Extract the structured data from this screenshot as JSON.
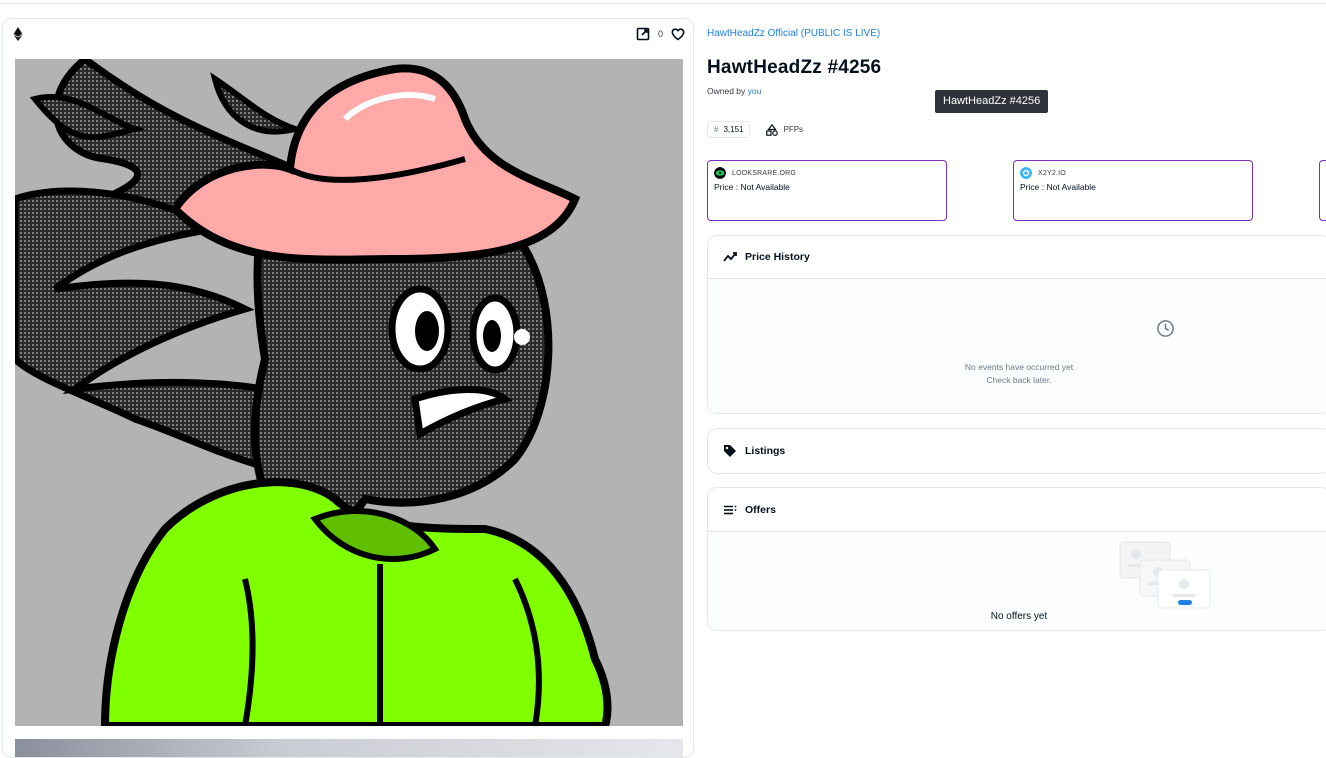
{
  "media": {
    "chain_icon": "ethereum-icon",
    "external_icon": "external-link-icon",
    "favorite_icon": "heart-icon",
    "favorite_count": "0",
    "art_icon": "nft-artwork-image"
  },
  "item": {
    "collection": "HawtHeadZz Official (PUBLIC IS LIVE)",
    "title": "HawtHeadZz #4256",
    "owned_prefix": "Owned by",
    "owner": "you",
    "tooltip": "HawtHeadZz  #4256",
    "rank_symbol": "#",
    "rank": "3,151",
    "category": "PFPs"
  },
  "markets": [
    {
      "name": "LOOKSRARE.ORG",
      "price": "Price : Not Available",
      "color": "#0ce466"
    },
    {
      "name": "X2Y2.IO",
      "price": "Price : Not Available",
      "color": "#3bb3f5"
    }
  ],
  "panels": {
    "price_history": {
      "label": "Price History",
      "empty_line1": "No events have occurred yet",
      "empty_line2": "Check back later."
    },
    "listings": {
      "label": "Listings"
    },
    "offers": {
      "label": "Offers",
      "empty": "No offers yet"
    }
  },
  "colors": {
    "accent": "#2081e2",
    "market_border": "#7b2fbf",
    "jacket": "#7fff00",
    "hat": "#ffaaa8"
  }
}
